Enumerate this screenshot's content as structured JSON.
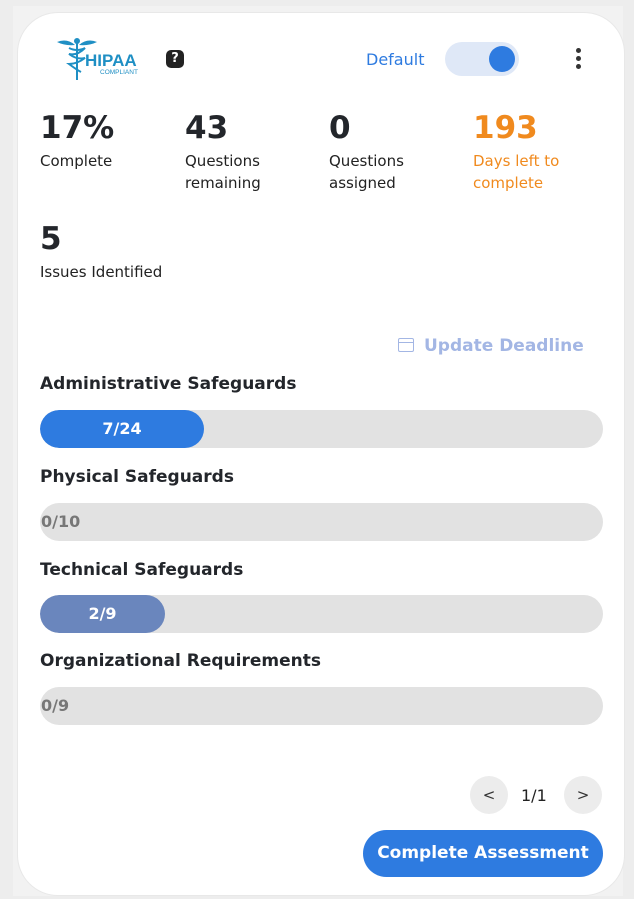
{
  "header": {
    "logo_text": "HIPAA",
    "logo_subtext": "COMPLIANT",
    "help_glyph": "?",
    "toggle_label": "Default",
    "toggle_on": true
  },
  "stats": [
    {
      "value": "17%",
      "label": "Complete"
    },
    {
      "value": "43",
      "label": "Questions remaining"
    },
    {
      "value": "0",
      "label": "Questions assigned"
    },
    {
      "value": "193",
      "label": "Days left to complete"
    },
    {
      "value": "5",
      "label": "Issues Identified"
    }
  ],
  "update_deadline_label": "Update Deadline",
  "sections": [
    {
      "title": "Administrative Safeguards",
      "progress": "7/24",
      "done": 7,
      "total": 24,
      "color": "#2e7be0"
    },
    {
      "title": "Physical Safeguards",
      "progress": "0/10",
      "done": 0,
      "total": 10,
      "color": "#2e7be0"
    },
    {
      "title": "Technical Safeguards",
      "progress": "2/9",
      "done": 2,
      "total": 9,
      "color": "#6a86bd"
    },
    {
      "title": "Organizational Requirements",
      "progress": "0/9",
      "done": 0,
      "total": 9,
      "color": "#2e7be0"
    }
  ],
  "pagination": {
    "prev": "<",
    "label": "1/1",
    "next": ">"
  },
  "complete_button": "Complete Assessment",
  "colors": {
    "accent": "#2e7be0",
    "warning": "#f08a1e",
    "muted_link": "#a3b6e4"
  }
}
